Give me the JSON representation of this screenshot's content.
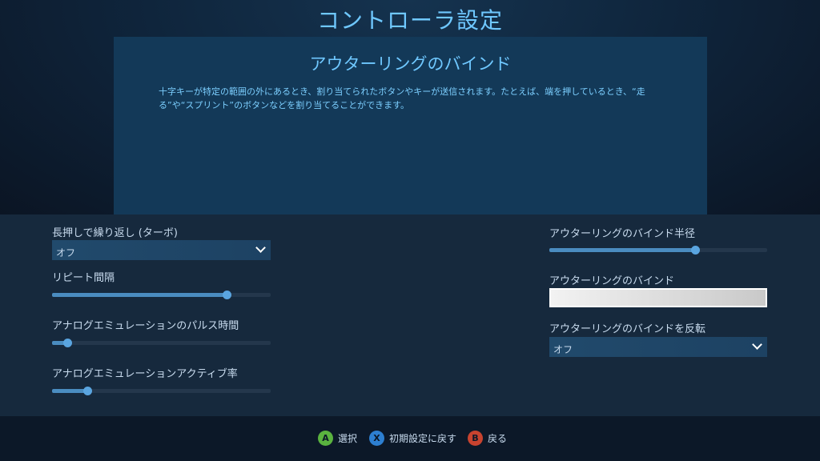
{
  "header": {
    "title": "コントローラ設定"
  },
  "description": {
    "title": "アウターリングのバインド",
    "text": "十字キーが特定の範囲の外にあるとき、割り当てられたボタンやキーが送信されます。たとえば、端を押しているとき、“走る”や“スプリント”のボタンなどを割り当てることができます。"
  },
  "left": {
    "turbo": {
      "label": "長押しで繰り返し (ターボ)",
      "value": "オフ"
    },
    "repeat_interval": {
      "label": "リピート間隔",
      "level": 0.8
    },
    "pulse_time": {
      "label": "アナログエミュレーションのパルス時間",
      "level": 0.07
    },
    "active_rate": {
      "label": "アナログエミュレーションアクティブ率",
      "level": 0.16
    }
  },
  "right": {
    "radius": {
      "label": "アウターリングのバインド半径",
      "level": 0.67
    },
    "binding": {
      "label": "アウターリングのバインド",
      "value": ""
    },
    "invert": {
      "label": "アウターリングのバインドを反転",
      "value": "オフ"
    }
  },
  "footer": {
    "select": {
      "key": "A",
      "label": "選択",
      "color": "#5ab33f"
    },
    "reset": {
      "key": "X",
      "label": "初期設定に戻す",
      "color": "#2d7fd1"
    },
    "back": {
      "key": "B",
      "label": "戻る",
      "color": "#c8432f"
    }
  }
}
